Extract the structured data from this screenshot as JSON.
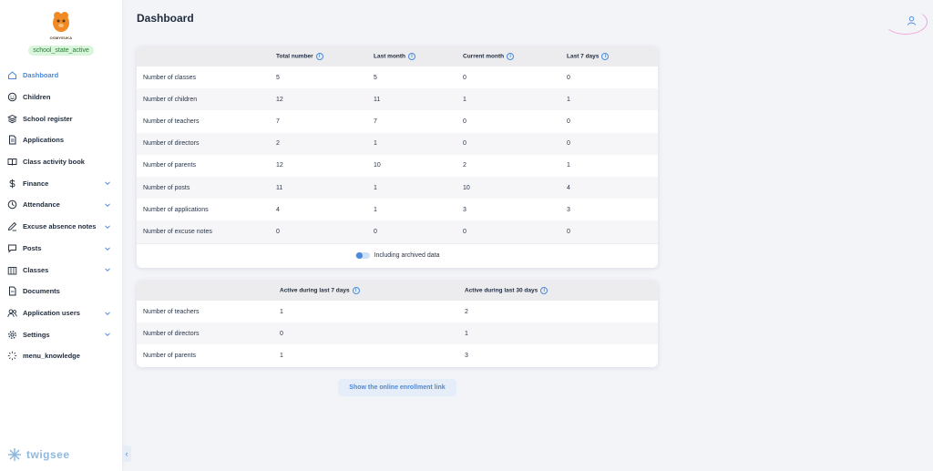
{
  "school": {
    "state_badge": "school_state_active",
    "logo_name": "OSMYEUKA"
  },
  "sidebar": {
    "items": [
      {
        "label": "Dashboard",
        "icon": "home-icon",
        "active": true,
        "has_chevron": false
      },
      {
        "label": "Children",
        "icon": "smile-icon",
        "active": false,
        "has_chevron": false
      },
      {
        "label": "School register",
        "icon": "layers-icon",
        "active": false,
        "has_chevron": false
      },
      {
        "label": "Applications",
        "icon": "document-icon",
        "active": false,
        "has_chevron": false
      },
      {
        "label": "Class activity book",
        "icon": "book-icon",
        "active": false,
        "has_chevron": false
      },
      {
        "label": "Finance",
        "icon": "dollar-icon",
        "active": false,
        "has_chevron": true
      },
      {
        "label": "Attendance",
        "icon": "clock-icon",
        "active": false,
        "has_chevron": true
      },
      {
        "label": "Excuse absence notes",
        "icon": "pencil-icon",
        "active": false,
        "has_chevron": true
      },
      {
        "label": "Posts",
        "icon": "chat-icon",
        "active": false,
        "has_chevron": true
      },
      {
        "label": "Classes",
        "icon": "building-icon",
        "active": false,
        "has_chevron": true
      },
      {
        "label": "Documents",
        "icon": "file-icon",
        "active": false,
        "has_chevron": false
      },
      {
        "label": "Application users",
        "icon": "users-icon",
        "active": false,
        "has_chevron": true
      },
      {
        "label": "Settings",
        "icon": "gear-icon",
        "active": false,
        "has_chevron": true
      },
      {
        "label": "menu_knowledge",
        "icon": "bulb-icon",
        "active": false,
        "has_chevron": false
      }
    ],
    "brand": "twigsee"
  },
  "header": {
    "title": "Dashboard"
  },
  "stats_table": {
    "columns": [
      "",
      "Total number",
      "Last month",
      "Current month",
      "Last 7 days"
    ],
    "rows": [
      [
        "Number of classes",
        "5",
        "5",
        "0",
        "0"
      ],
      [
        "Number of children",
        "12",
        "11",
        "1",
        "1"
      ],
      [
        "Number of teachers",
        "7",
        "7",
        "0",
        "0"
      ],
      [
        "Number of directors",
        "2",
        "1",
        "0",
        "0"
      ],
      [
        "Number of parents",
        "12",
        "10",
        "2",
        "1"
      ],
      [
        "Number of posts",
        "11",
        "1",
        "10",
        "4"
      ],
      [
        "Number of applications",
        "4",
        "1",
        "3",
        "3"
      ],
      [
        "Number of excuse notes",
        "0",
        "0",
        "0",
        "0"
      ]
    ],
    "toggle_label": "Including archived data"
  },
  "activity_table": {
    "columns": [
      "",
      "Active during last 7 days",
      "Active during last 30 days"
    ],
    "rows": [
      [
        "Number of teachers",
        "1",
        "2"
      ],
      [
        "Number of directors",
        "0",
        "1"
      ],
      [
        "Number of parents",
        "1",
        "3"
      ]
    ]
  },
  "enroll_button": "Show the online enrollment link",
  "colors": {
    "accent": "#4a89dc",
    "badge_bg": "#d9f5dc",
    "header_row": "#ececef"
  }
}
